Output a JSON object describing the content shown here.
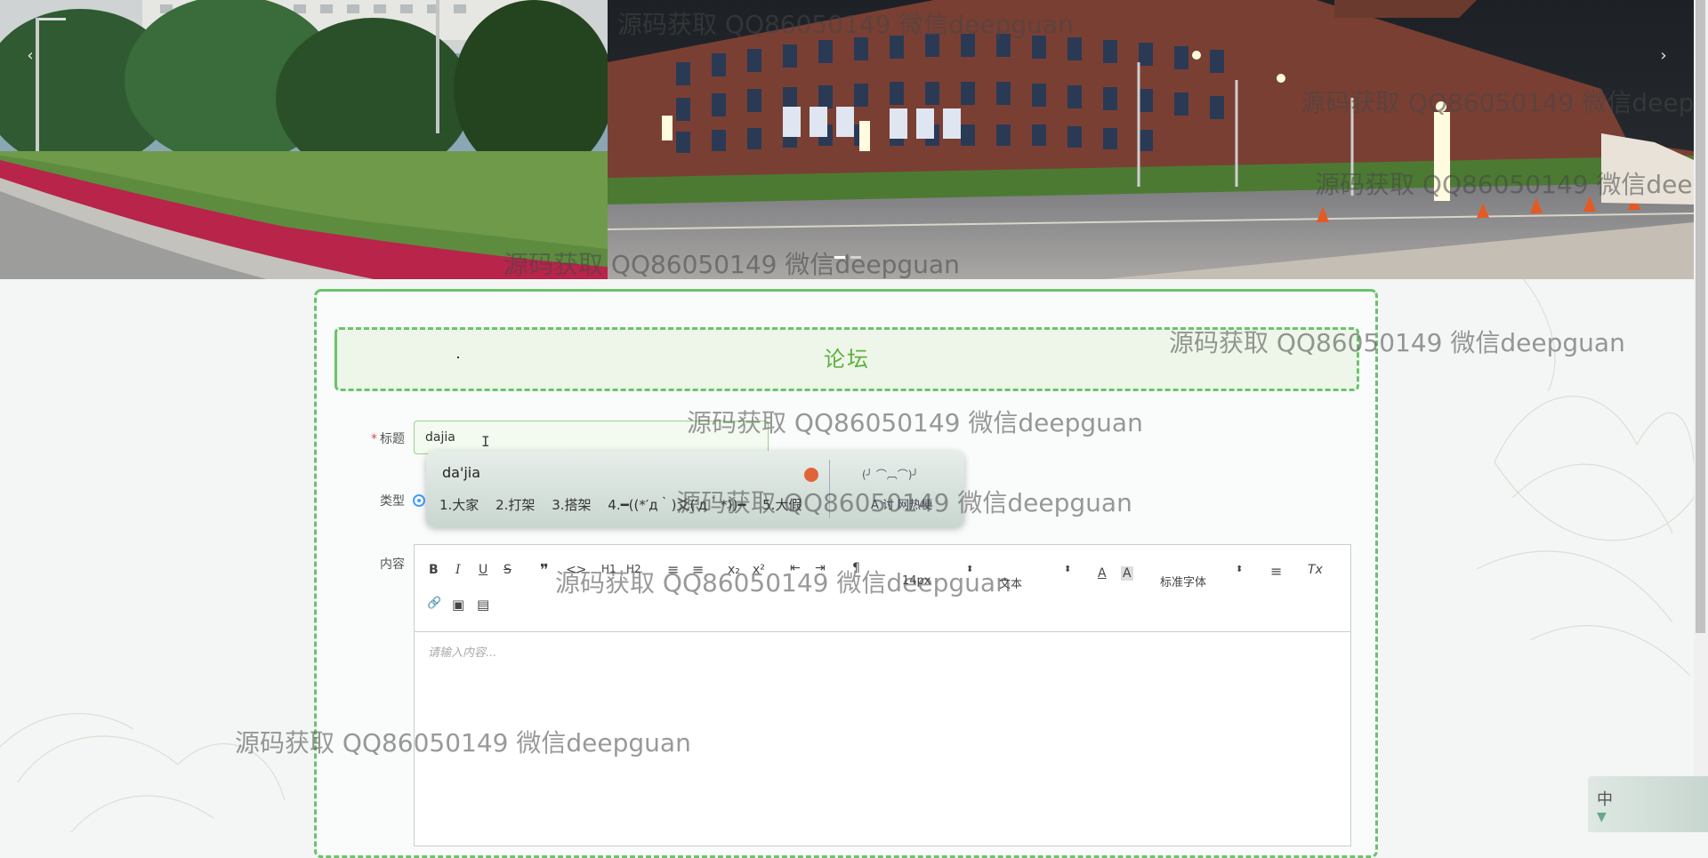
{
  "carousel": {
    "prev_label": "‹",
    "next_label": "›",
    "dot_count": 2
  },
  "forum": {
    "section_title": "论坛",
    "title_label": "标题",
    "title_required": "*",
    "title_value": "dajia",
    "type_label": "类型",
    "content_label": "内容"
  },
  "editor": {
    "toolbar": {
      "bold": "B",
      "italic": "I",
      "underline": "U",
      "strike": "S",
      "blockquote": "❞",
      "code": "<>",
      "h1": "H1",
      "h2": "H2",
      "ordered_list": "≡",
      "bullet_list": "≡",
      "subscript": "x₂",
      "superscript": "x²",
      "indent_left": "⇤",
      "indent_right": "⇥",
      "direction": "¶",
      "size_select": "14px",
      "header_select": "文本",
      "color": "A",
      "background": "A",
      "font_select": "标准字体",
      "align": "≡",
      "clean": "Tx",
      "link": "🔗",
      "image": "▣",
      "video": "▤"
    },
    "placeholder": "请输入内容..."
  },
  "ime": {
    "composition": "da'jia",
    "candidates": [
      "1.大家",
      "2.打架",
      "3.搭架",
      "4.━((*′д｀)爻(′д｀*))━",
      "5.大假"
    ],
    "more": "›",
    "skin_text": "(╯ ⌒︹⌒)╯",
    "fav_text": "A 讨 网热梗"
  },
  "ime_status": {
    "mode": "中"
  },
  "watermarks": [
    "源码获取 QQ86050149 微信deepguan",
    "源码获取 QQ86050149 微信deepguan",
    "源码获取 QQ86050149 微信deepguan",
    "源码获取 QQ86050149 微信deepguan",
    "源码获取 QQ86050149 微信deepguan",
    "源码获取 QQ86050149 微信deepguan",
    "源码获取 QQ86050149 微信deepguan",
    "源码获取 QQ86050149 微信deepguan",
    "源码获取 QQ86050149 微信deepguan"
  ],
  "colors": {
    "accent_green": "#6cc36c",
    "title_green": "#5fb03f",
    "radio_blue": "#409eff",
    "required_red": "#e04a4a"
  }
}
